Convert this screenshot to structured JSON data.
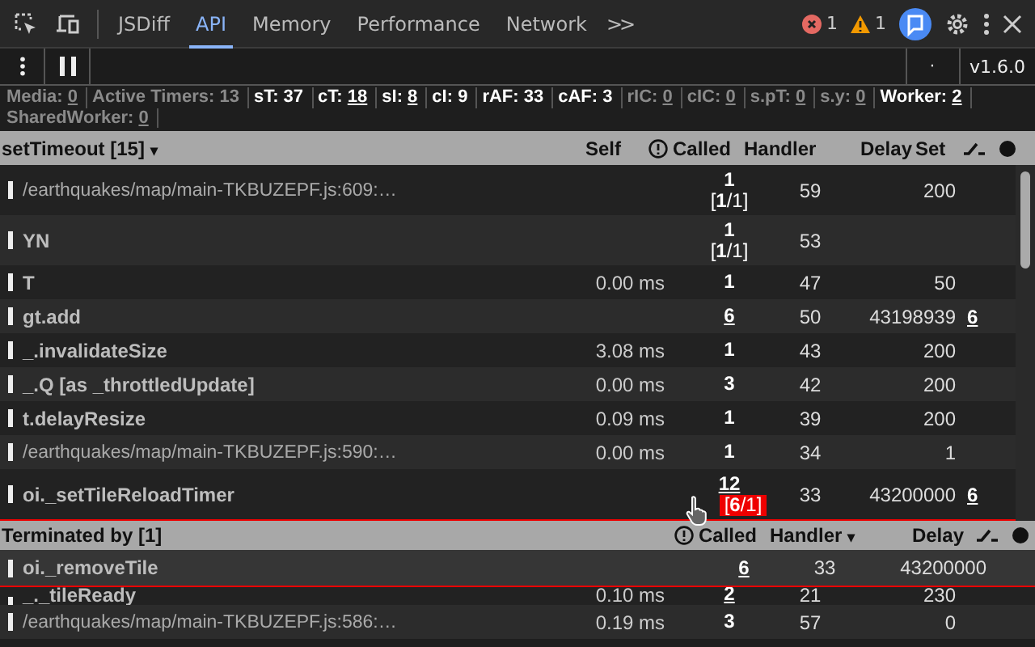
{
  "tabs": [
    {
      "label": "JSDiff",
      "selected": false
    },
    {
      "label": "API",
      "selected": true
    },
    {
      "label": "Memory",
      "selected": false
    },
    {
      "label": "Performance",
      "selected": false
    },
    {
      "label": "Network",
      "selected": false
    }
  ],
  "more_tabs": ">>",
  "errors": "1",
  "warnings": "1",
  "toolbar": {
    "dot": "·",
    "version": "v1.6.0"
  },
  "counters": [
    {
      "label": "Media:",
      "value": "0",
      "active": false,
      "link": true
    },
    {
      "label": "Active Timers:",
      "value": "13",
      "active": false,
      "link": false
    },
    {
      "label": "sT:",
      "value": "37",
      "active": true,
      "link": false
    },
    {
      "label": "cT:",
      "value": "18",
      "active": true,
      "link": true
    },
    {
      "label": "sI:",
      "value": "8",
      "active": true,
      "link": true
    },
    {
      "label": "cI:",
      "value": "9",
      "active": true,
      "link": false
    },
    {
      "label": "rAF:",
      "value": "33",
      "active": true,
      "link": false
    },
    {
      "label": "cAF:",
      "value": "3",
      "active": true,
      "link": false
    },
    {
      "label": "rIC:",
      "value": "0",
      "active": false,
      "link": true
    },
    {
      "label": "cIC:",
      "value": "0",
      "active": false,
      "link": true
    },
    {
      "label": "s.pT:",
      "value": "0",
      "active": false,
      "link": true
    },
    {
      "label": "s.y:",
      "value": "0",
      "active": false,
      "link": true
    },
    {
      "label": "Worker:",
      "value": "2",
      "active": true,
      "link": true
    },
    {
      "label": "SharedWorker:",
      "value": "0",
      "active": false,
      "link": true
    }
  ],
  "table": {
    "title": "setTimeout [15]",
    "sort": "▾",
    "columns": [
      "Self",
      "Called",
      "Handler",
      "Delay",
      "Set"
    ],
    "rows": [
      {
        "name": "/earthquakes/map/main-TKBUZEPF.js:609:…",
        "kind": "path",
        "called": "1",
        "called_link": false,
        "ratio": "[**1**/1]",
        "ratio_alert": false,
        "handler": "59",
        "delay": "200"
      },
      {
        "name": "YN",
        "kind": "func",
        "called": "1",
        "called_link": false,
        "ratio": "[**1**/1]",
        "ratio_alert": false,
        "handler": "53"
      },
      {
        "name": "T",
        "kind": "func",
        "self": "0.00 ms",
        "called": "1",
        "called_link": false,
        "handler": "47",
        "delay": "50"
      },
      {
        "name": "gt.add",
        "kind": "func",
        "called": "6",
        "called_link": true,
        "handler": "50",
        "delay": "43198939",
        "set": "6"
      },
      {
        "name": "_.invalidateSize",
        "kind": "func",
        "self": "3.08 ms",
        "called": "1",
        "called_link": false,
        "handler": "43",
        "delay": "200"
      },
      {
        "name": "_.Q [as _throttledUpdate]",
        "kind": "func",
        "self": "0.00 ms",
        "called": "3",
        "called_link": false,
        "handler": "42",
        "delay": "200"
      },
      {
        "name": "t.delayResize",
        "kind": "func",
        "self": "0.09 ms",
        "called": "1",
        "called_link": false,
        "handler": "39",
        "delay": "200"
      },
      {
        "name": "/earthquakes/map/main-TKBUZEPF.js:590:…",
        "kind": "path",
        "self": "0.00 ms",
        "called": "1",
        "called_link": false,
        "handler": "34",
        "delay": "1"
      },
      {
        "name": "oi._setTileReloadTimer",
        "kind": "func",
        "called": "12",
        "called_link": true,
        "ratio": "[**6**/1]",
        "ratio_alert": true,
        "handler": "33",
        "delay": "43200000",
        "set": "6"
      }
    ]
  },
  "popup": {
    "title": "Terminated by [1]",
    "columns": [
      "Called",
      "Handler",
      "Delay"
    ],
    "sort": "▾",
    "rows": [
      {
        "name": "oi._removeTile",
        "called": "6",
        "handler": "33",
        "delay": "43200000"
      }
    ]
  },
  "rows_after": [
    {
      "name": "_._tileReady",
      "kind": "func",
      "self": "0.10 ms",
      "called": "2",
      "called_link": true,
      "handler": "21",
      "delay": "230"
    },
    {
      "name": "/earthquakes/map/main-TKBUZEPF.js:586:…",
      "kind": "path",
      "self": "0.19 ms",
      "called": "3",
      "called_link": false,
      "handler": "57",
      "delay": "0"
    }
  ]
}
